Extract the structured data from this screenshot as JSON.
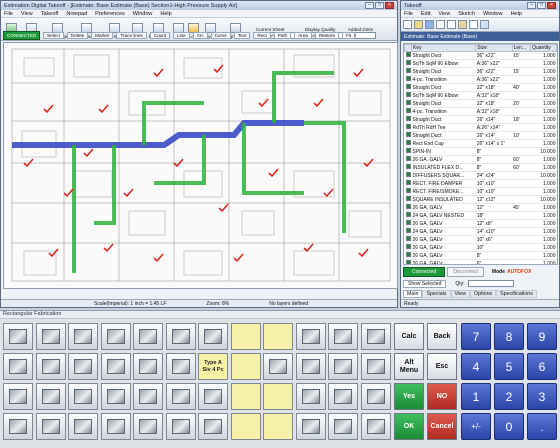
{
  "main_window": {
    "title": "Estimation Digital Takeoff - [Estimate: Base Estimate (Base)   Section1-High Pressure Supply Air]",
    "menu": [
      "File",
      "View",
      "Takeoff",
      "Notepad",
      "Preferences",
      "Window",
      "Help"
    ],
    "toolbar": [
      "Takeoff",
      "Notepad",
      "Crop Images",
      "Print Image",
      "Save Image",
      "Sheets",
      "Revisions",
      "Scale",
      "Lock",
      "Layers",
      "Assign Layers",
      "Curve",
      "Text",
      "Rect",
      "Line",
      "Path",
      "Area",
      "Restore",
      "Fit"
    ],
    "left_tools": [
      "CONNECTED",
      "Select",
      "Delete",
      "Marker",
      "Trace lines",
      "Count",
      "Line",
      "Arc"
    ],
    "current_sheet_label": "Current Sheet",
    "current_sheet_value": "M2-00A",
    "display_quality_label": "Display Quality",
    "display_quality_value": "Scale to gray",
    "added_dims_label": "Added Dims",
    "added_dims_value": "3.0",
    "status": {
      "scale": "Scale(Imperial): 1 inch = 1.45 LF",
      "zoom": "Zoom: 8%",
      "layers": "No layers defined"
    }
  },
  "takeoff_window": {
    "title": "Takeoff",
    "menu": [
      "File",
      "Edit",
      "View",
      "Sketch",
      "Window",
      "Help"
    ],
    "subtitle": "Estimate: Base Estimate (Base)",
    "columns": [
      "",
      "Key",
      "Size",
      "Len...",
      "Quantity"
    ],
    "rows": [
      {
        "checked": true,
        "key": "Straight Duct",
        "size": "36\" x22\"",
        "len": "15'",
        "qty": "1.000"
      },
      {
        "checked": true,
        "key": "SqTh SqM 90 Elbow",
        "size": "A:36\" x22\"",
        "len": "",
        "qty": "1.000"
      },
      {
        "checked": true,
        "key": "Straight Duct",
        "size": "36\" x22\"",
        "len": "15'",
        "qty": "1.000"
      },
      {
        "checked": true,
        "key": "4-pc. Transition",
        "size": "A:36\" x22\"",
        "len": "",
        "qty": "1.000"
      },
      {
        "checked": true,
        "key": "Straight Duct",
        "size": "32\" x18\"",
        "len": "40'",
        "qty": "1.000"
      },
      {
        "checked": true,
        "key": "SqTh SqM 90 Elbow",
        "size": "A:32\" x18\"",
        "len": "",
        "qty": "1.000"
      },
      {
        "checked": true,
        "key": "Straight Duct",
        "size": "32\" x18\"",
        "len": "20'",
        "qty": "1.000"
      },
      {
        "checked": true,
        "key": "4-pc. Transition",
        "size": "A:32\" x18\"",
        "len": "",
        "qty": "1.000"
      },
      {
        "checked": true,
        "key": "Straight Duct",
        "size": "26\" x14\"",
        "len": "18'",
        "qty": "1.000"
      },
      {
        "checked": true,
        "key": "RdTh RdH Tee",
        "size": "A:26\" x14\"",
        "len": "",
        "qty": "1.000"
      },
      {
        "checked": true,
        "key": "Straight Duct",
        "size": "26\" x14\"",
        "len": "10'",
        "qty": "1.000"
      },
      {
        "checked": true,
        "key": "Rect End Cap",
        "size": "26\" x14\" x 1\"",
        "len": "",
        "qty": "1.000"
      },
      {
        "checked": true,
        "key": "SPIN-IN",
        "size": "8\"",
        "len": "",
        "qty": "10.000"
      },
      {
        "checked": true,
        "key": "26 GA. GALV",
        "size": "8\"",
        "len": "60'",
        "qty": "1.000"
      },
      {
        "checked": true,
        "key": "INSULATED FLEX D...",
        "size": "8\"",
        "len": "60'",
        "qty": "1.000"
      },
      {
        "checked": true,
        "key": "DIFFUSERS SQUAR...",
        "size": "24\" x24\"",
        "len": "",
        "qty": "10.000"
      },
      {
        "checked": true,
        "key": "RECT. FIRE DAMPER",
        "size": "10\" x10\"",
        "len": "",
        "qty": "1.000"
      },
      {
        "checked": true,
        "key": "RECT. FIRE/SMOKE...",
        "size": "10\" x10\"",
        "len": "",
        "qty": "1.000"
      },
      {
        "checked": true,
        "key": "SQUARE INSULATED",
        "size": "12\" x12\"",
        "len": "",
        "qty": "10.000"
      },
      {
        "checked": true,
        "key": "26 GA. GALV",
        "size": "12\"",
        "len": "45'",
        "qty": "1.000"
      },
      {
        "checked": true,
        "key": "24 GA. GALV NESTED",
        "size": "18\"",
        "len": "",
        "qty": "1.000"
      },
      {
        "checked": true,
        "key": "26 GA. GALV",
        "size": "12\" x8\"",
        "len": "",
        "qty": "1.000"
      },
      {
        "checked": true,
        "key": "24 GA. GALV",
        "size": "14\" x10\"",
        "len": "",
        "qty": "1.000"
      },
      {
        "checked": true,
        "key": "26 GA. GALV",
        "size": "10\" x6\"",
        "len": "",
        "qty": "1.000"
      },
      {
        "checked": true,
        "key": "26 GA. GALV",
        "size": "10\"",
        "len": "",
        "qty": "1.000"
      },
      {
        "checked": true,
        "key": "26 GA. GALV",
        "size": "8\"",
        "len": "",
        "qty": "1.000"
      },
      {
        "checked": true,
        "key": "26 GA. GALV",
        "size": "6\"",
        "len": "",
        "qty": "1.000"
      },
      {
        "checked": true,
        "key": "26 GA. GALV",
        "size": "8\"",
        "len": "",
        "qty": "1.000"
      }
    ],
    "connected_label": "Connected",
    "disconnect_label": "Disconnect",
    "mode_label": "Mode",
    "mode_value": "AUTOFOX",
    "show_selected_label": "Show Selected",
    "qty_label": "Qty:",
    "tabs": [
      "Main",
      "Specials",
      "View",
      "Options",
      "Specifications"
    ],
    "ready": "Ready"
  },
  "fabrication_panel": {
    "title": "Rectangular Fabrication",
    "type_tile_label": "Type A\nSiv 4 Pc",
    "keys": {
      "calc": "Calc",
      "back": "Back",
      "alt_menu": "Alt\nMenu",
      "esc": "Esc",
      "yes": "Yes",
      "no": "NO",
      "ok": "OK",
      "cancel": "Cancel"
    },
    "numpad": [
      "7",
      "8",
      "9",
      "4",
      "5",
      "6",
      "1",
      "2",
      "3",
      "+/-",
      "0",
      "."
    ]
  },
  "colors": {
    "supply_duct": "#2db33a",
    "main_duct": "#2f3fc4",
    "takeoff_marker": "#e0281f",
    "connected_green": "#1e9a3a",
    "numpad_blue": "#2b44a8"
  }
}
